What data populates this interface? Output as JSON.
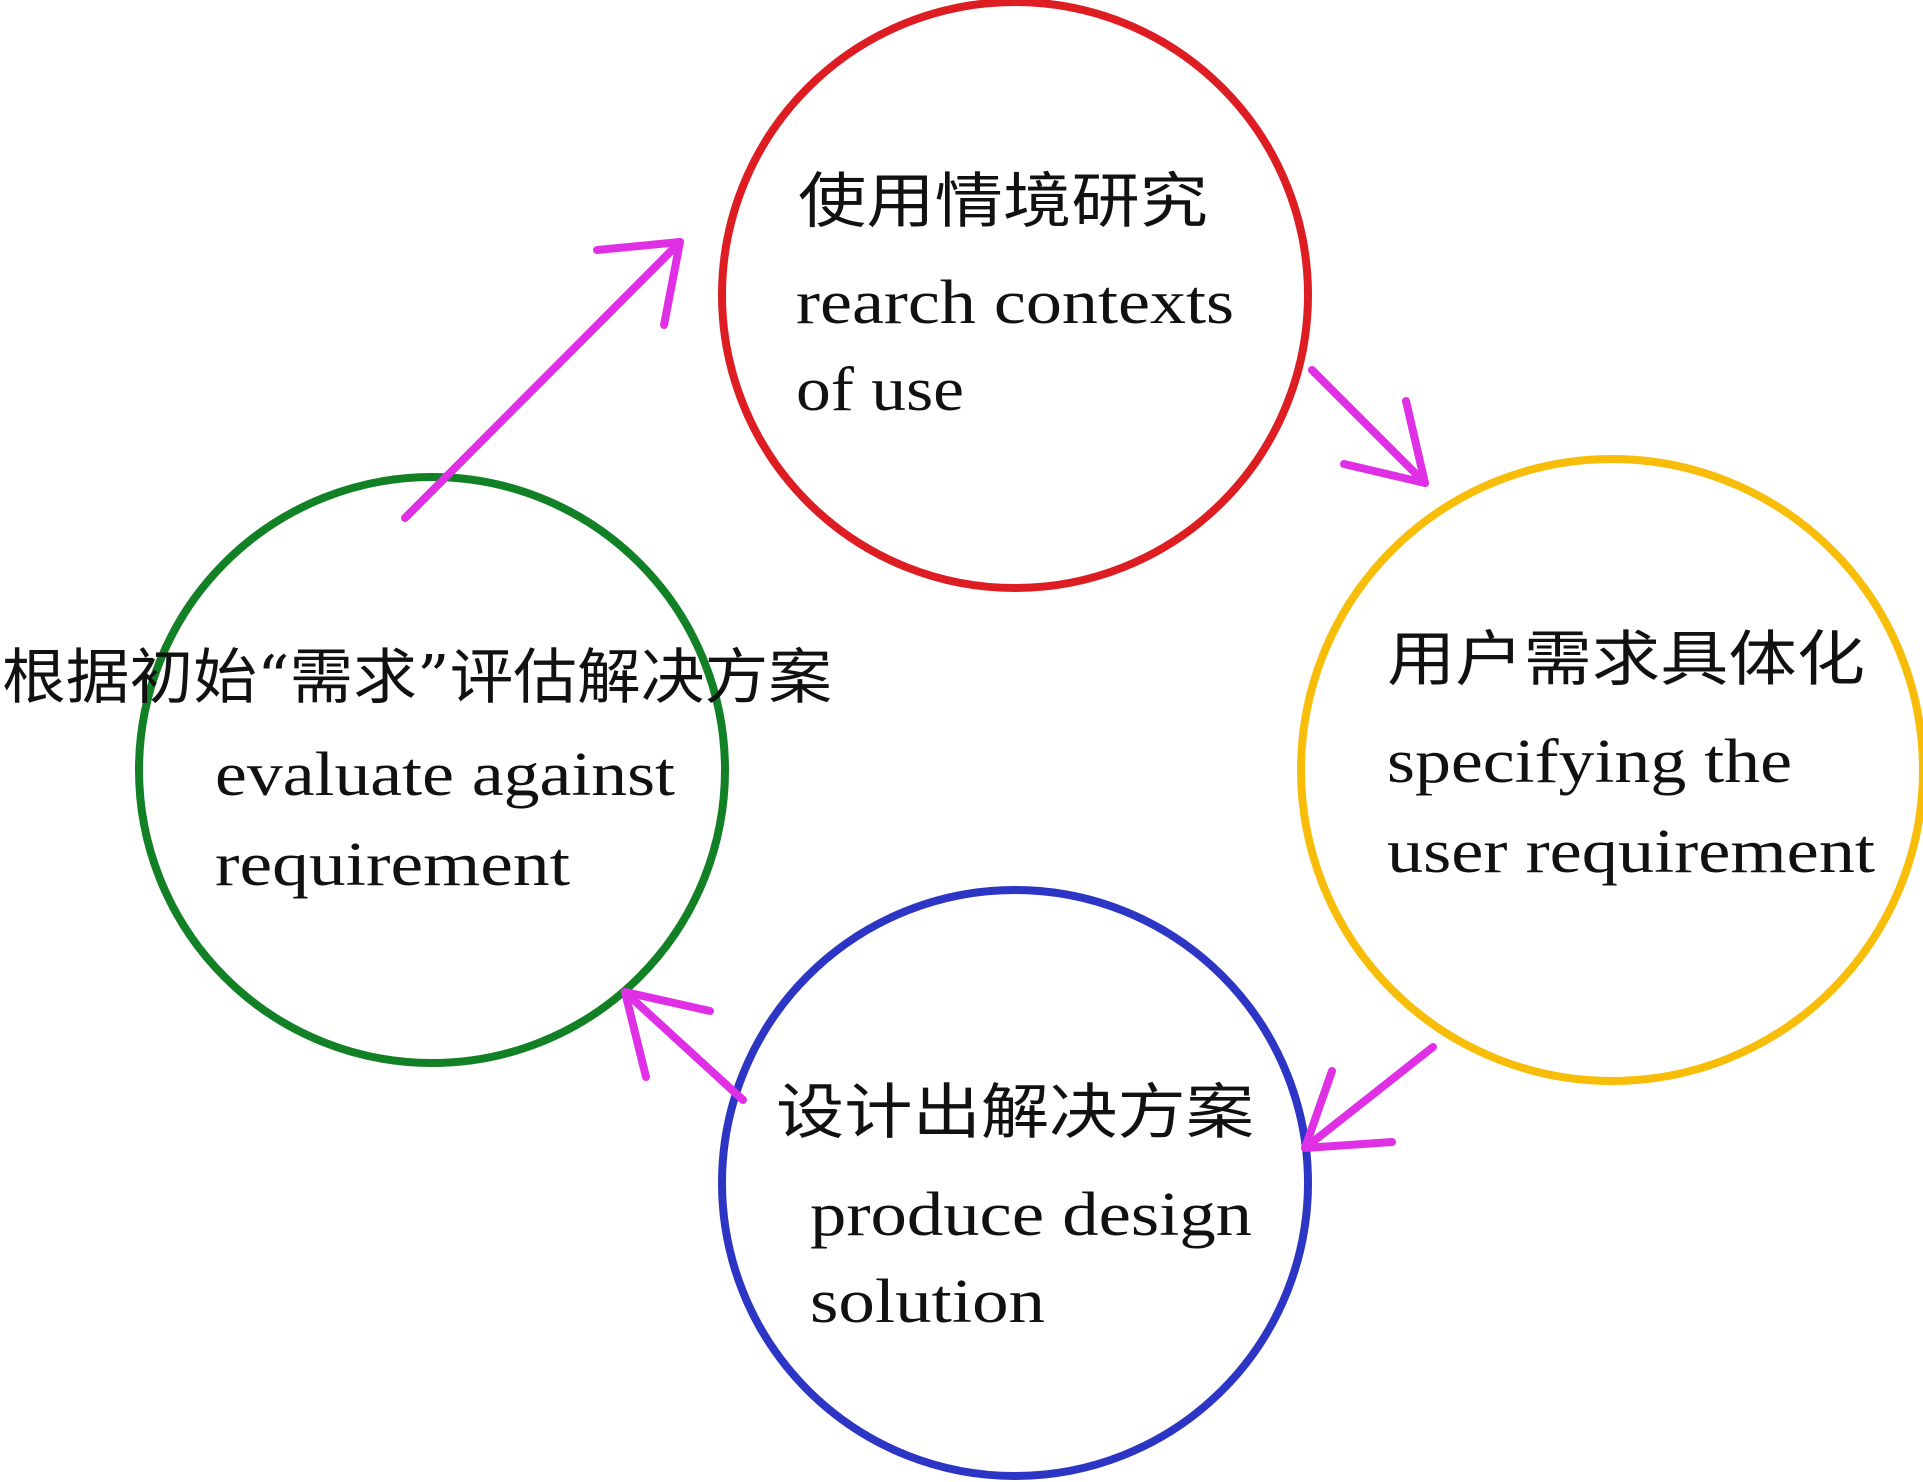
{
  "colors": {
    "research": "#de1d23",
    "specify": "#f7bd08",
    "produce": "#2c35c4",
    "evaluate": "#128024",
    "arrow": "#e030e6",
    "text": "#111111"
  },
  "nodes": {
    "research": {
      "zh": "使用情境研究",
      "en_line1": "rearch contexts",
      "en_line2": "of use"
    },
    "specify": {
      "zh": "用户需求具体化",
      "en_line1": "specifying  the",
      "en_line2": "user requirement"
    },
    "produce": {
      "zh": "设计出解决方案",
      "en_line1": "produce design",
      "en_line2": "solution"
    },
    "evaluate": {
      "zh": "根据初始“需求”评估解决方案",
      "en_line1": "evaluate  against",
      "en_line2": "requirement"
    }
  }
}
